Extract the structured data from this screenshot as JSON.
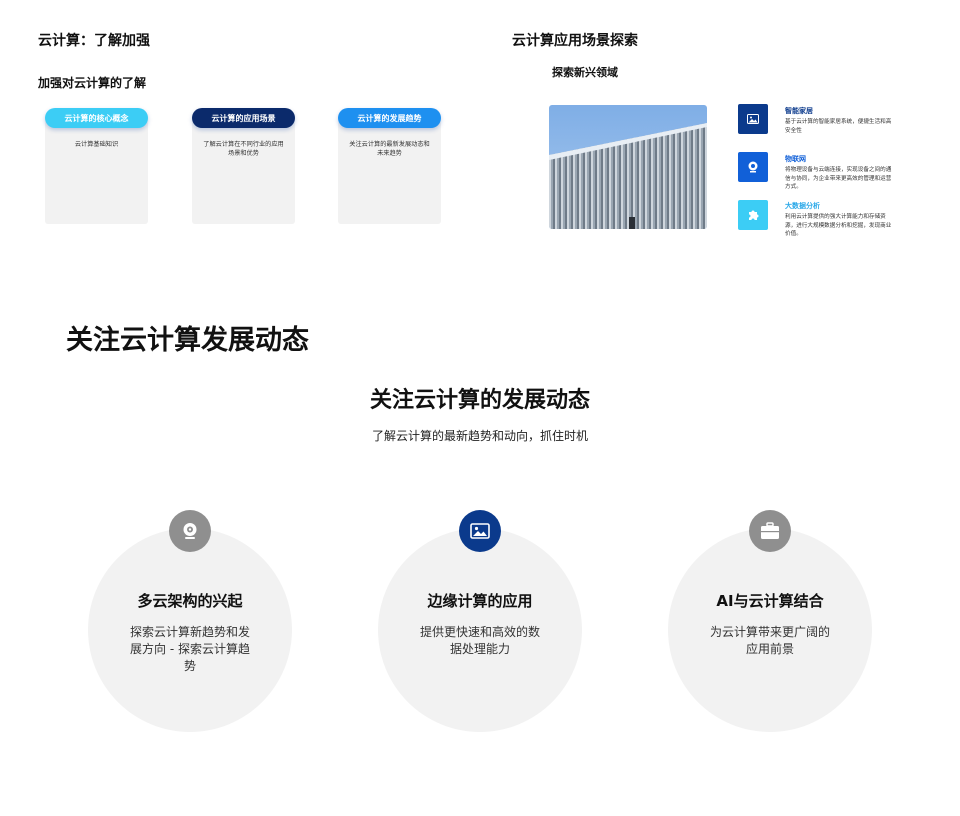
{
  "left_slide": {
    "title": "云计算：了解加强",
    "subtitle": "加强对云计算的了解",
    "cards": [
      {
        "label": "云计算的核心概念",
        "text": "云计算基础知识",
        "color": "#3ccdf5"
      },
      {
        "label": "云计算的应用场景",
        "text": "了解云计算在不同行业的应用场景和优势",
        "color": "#0b2a6b"
      },
      {
        "label": "云计算的发展趋势",
        "text": "关注云计算的最新发展动态和未来趋势",
        "color": "#1e90f0"
      }
    ]
  },
  "right_slide": {
    "title": "云计算应用场景探索",
    "subtitle": "探索新兴领域",
    "features": [
      {
        "title": "智能家居",
        "desc": "基于云计算的智能家居系统，便捷生活和高安全性",
        "icon": "image-icon",
        "icon_color": "#0b3a8c",
        "title_color": "#0b3a8c"
      },
      {
        "title": "物联网",
        "desc": "将物理设备与云端连接，实现设备之间的通信与协同，为企业带来更高效的管理和运营方式。",
        "icon": "webcam-icon",
        "icon_color": "#1160d8",
        "title_color": "#1160d8"
      },
      {
        "title": "大数据分析",
        "desc": "利用云计算提供的强大计算能力和存储资源，进行大规模数据分析和挖掘，发现商业价值。",
        "icon": "puzzle-icon",
        "icon_color": "#3ccdf5",
        "title_color": "#2aa8e8"
      }
    ]
  },
  "bottom_slide": {
    "title": "关注云计算发展动态",
    "heading": "关注云计算的发展动态",
    "subheading": "了解云计算的最新趋势和动向，抓住时机",
    "items": [
      {
        "title": "多云架构的兴起",
        "desc": "探索云计算新趋势和发展方向 - 探索云计算趋势",
        "icon": "webcam-icon",
        "badge_color": "#8f8f8f"
      },
      {
        "title": "边缘计算的应用",
        "desc": "提供更快速和高效的数据处理能力",
        "icon": "image-icon",
        "badge_color": "#0b3a8c"
      },
      {
        "title": "AI与云计算结合",
        "desc": "为云计算带来更广阔的应用前景",
        "icon": "briefcase-icon",
        "badge_color": "#8f8f8f"
      }
    ]
  }
}
